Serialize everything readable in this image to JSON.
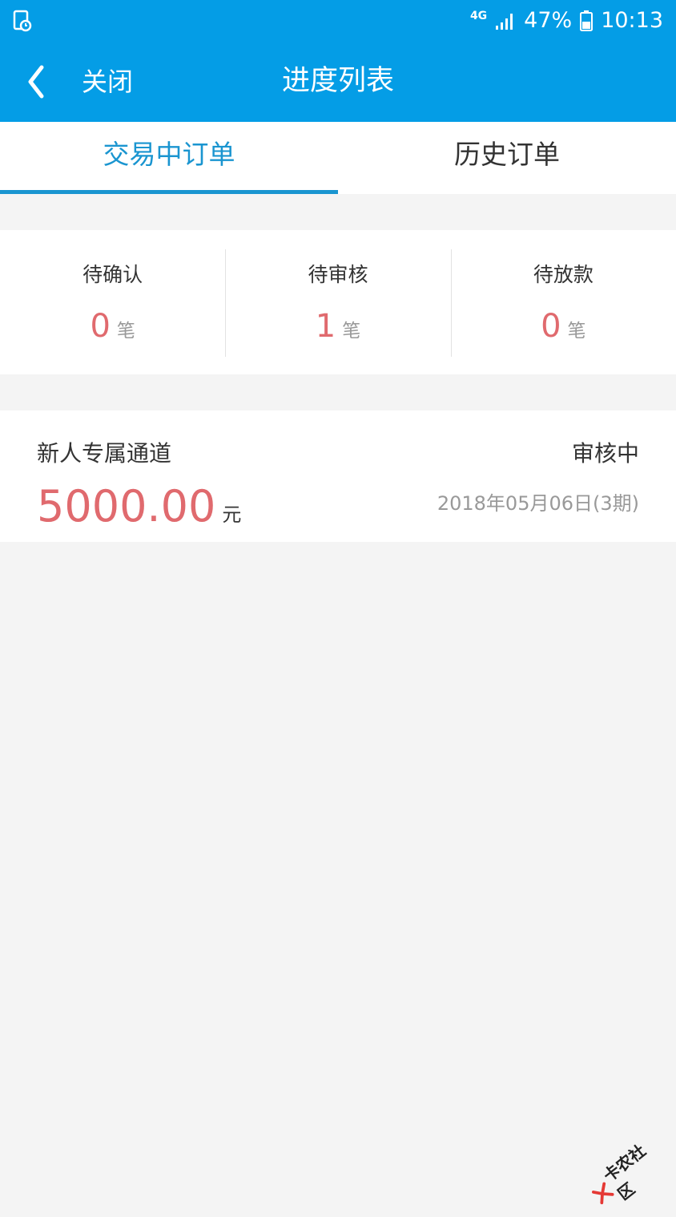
{
  "status_bar": {
    "network": "4G",
    "battery": "47%",
    "time": "10:13"
  },
  "nav": {
    "close_label": "关闭",
    "title": "进度列表"
  },
  "tabs": [
    {
      "label": "交易中订单",
      "active": true
    },
    {
      "label": "历史订单",
      "active": false
    }
  ],
  "stats": [
    {
      "label": "待确认",
      "count": "0",
      "unit": "笔"
    },
    {
      "label": "待审核",
      "count": "1",
      "unit": "笔"
    },
    {
      "label": "待放款",
      "count": "0",
      "unit": "笔"
    }
  ],
  "order": {
    "name": "新人专属通道",
    "status": "审核中",
    "amount": "5000.00",
    "unit": "元",
    "date": "2018年05月06日(3期)"
  },
  "watermark": {
    "text": "卡农社区"
  },
  "colors": {
    "header_bg": "#049de6",
    "accent": "#1a95d0",
    "highlight": "#e06a6e"
  }
}
